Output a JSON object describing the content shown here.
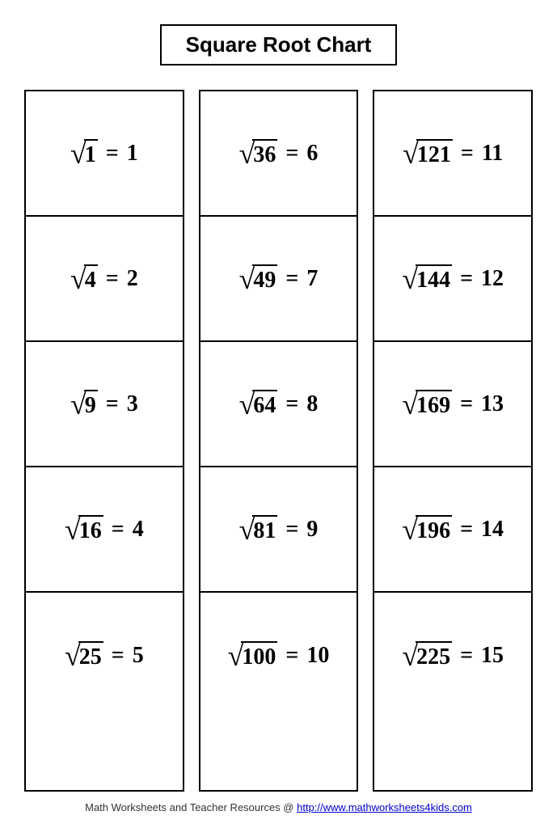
{
  "title": "Square Root Chart",
  "columns": [
    {
      "cells": [
        {
          "radicand": "1",
          "result": "1"
        },
        {
          "radicand": "4",
          "result": "2"
        },
        {
          "radicand": "9",
          "result": "3"
        },
        {
          "radicand": "16",
          "result": "4"
        },
        {
          "radicand": "25",
          "result": "5"
        }
      ]
    },
    {
      "cells": [
        {
          "radicand": "36",
          "result": "6"
        },
        {
          "radicand": "49",
          "result": "7"
        },
        {
          "radicand": "64",
          "result": "8"
        },
        {
          "radicand": "81",
          "result": "9"
        },
        {
          "radicand": "100",
          "result": "10"
        }
      ]
    },
    {
      "cells": [
        {
          "radicand": "121",
          "result": "11"
        },
        {
          "radicand": "144",
          "result": "12"
        },
        {
          "radicand": "169",
          "result": "13"
        },
        {
          "radicand": "196",
          "result": "14"
        },
        {
          "radicand": "225",
          "result": "15"
        }
      ]
    }
  ],
  "footer": {
    "text": "Math Worksheets and Teacher Resources @ ",
    "link_text": "http://www.mathworksheets4kids.com",
    "link_href": "http://www.mathworksheets4kids.com"
  }
}
